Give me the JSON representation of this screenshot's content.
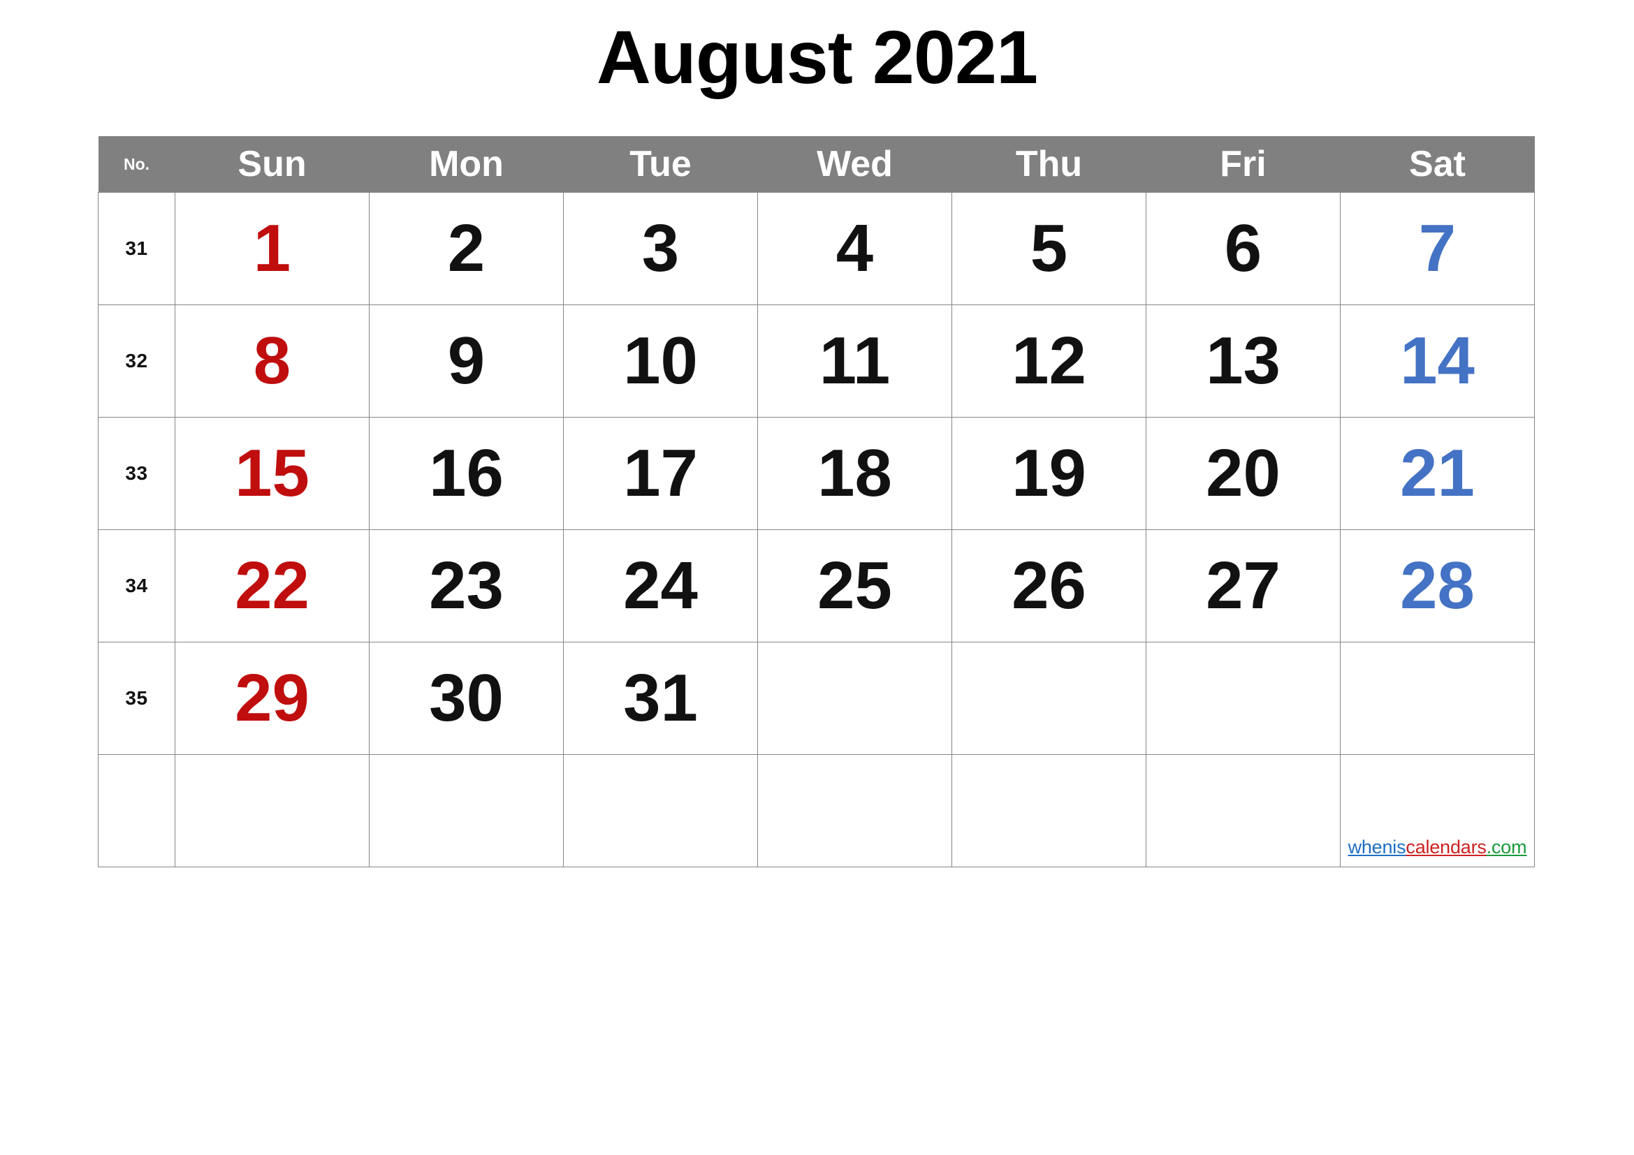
{
  "title": "August 2021",
  "colors": {
    "header_bg": "#808080",
    "header_text": "#ffffff",
    "sunday": "#C00D0D",
    "saturday": "#4472C4",
    "weekday": "#111111",
    "grid_line": "#868686",
    "credit_blue": "#1F6FC4",
    "credit_red": "#CC2222",
    "credit_green": "#1A9A3C"
  },
  "header": {
    "week_number_label": "No.",
    "days": [
      "Sun",
      "Mon",
      "Tue",
      "Wed",
      "Thu",
      "Fri",
      "Sat"
    ]
  },
  "weeks": [
    {
      "no": "31",
      "days": [
        "1",
        "2",
        "3",
        "4",
        "5",
        "6",
        "7"
      ]
    },
    {
      "no": "32",
      "days": [
        "8",
        "9",
        "10",
        "11",
        "12",
        "13",
        "14"
      ]
    },
    {
      "no": "33",
      "days": [
        "15",
        "16",
        "17",
        "18",
        "19",
        "20",
        "21"
      ]
    },
    {
      "no": "34",
      "days": [
        "22",
        "23",
        "24",
        "25",
        "26",
        "27",
        "28"
      ]
    },
    {
      "no": "35",
      "days": [
        "29",
        "30",
        "31",
        "",
        "",
        "",
        ""
      ]
    },
    {
      "no": "",
      "days": [
        "",
        "",
        "",
        "",
        "",
        "",
        ""
      ]
    }
  ],
  "credit": {
    "part1": "whenis",
    "part2": "calendars",
    "part3": ".com"
  }
}
